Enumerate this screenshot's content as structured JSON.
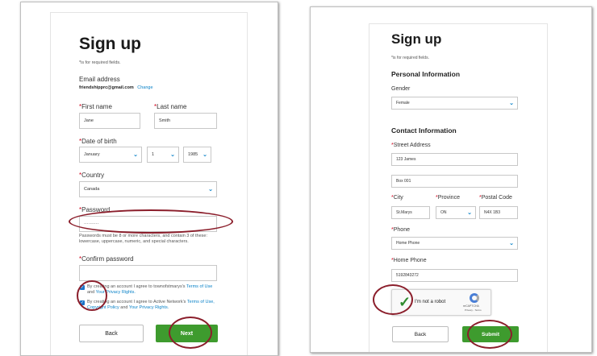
{
  "left": {
    "title": "Sign up",
    "required_note": "*is for required fields.",
    "email_label": "Email address",
    "email_value": "friendshipprc@gmail.com",
    "email_change": "Change",
    "first_name_label": "First name",
    "first_name_value": "Jane",
    "last_name_label": "Last name",
    "last_name_value": "Smith",
    "dob_label": "Date of birth",
    "dob_month": "January",
    "dob_day": "1",
    "dob_year": "1985",
    "country_label": "Country",
    "country_value": "Canada",
    "password_label": "Password",
    "password_value": "··········",
    "password_help": "Passwords must be 8 or more characters, and contain 3 of these: lowercase, uppercase, numeric, and special characters.",
    "confirm_label": "Confirm password",
    "consent1_prefix": "By creating an account I agree to townofstmarys's",
    "consent1_terms": "Terms of Use",
    "consent1_and": "and",
    "consent1_privacy": "Your Privacy Rights.",
    "consent2_prefix": "By creating an account I agree to Active Network's",
    "consent2_terms": "Terms of Use, Copyright Policy",
    "consent2_and": "and",
    "consent2_privacy": "Your Privacy Rights.",
    "back_label": "Back",
    "next_label": "Next"
  },
  "right": {
    "title": "Sign up",
    "required_note": "*is for required fields.",
    "personal_heading": "Personal Information",
    "gender_label": "Gender",
    "gender_value": "Female",
    "contact_heading": "Contact Information",
    "street_label": "Street Address",
    "street1_value": "123 James",
    "street2_value": "Box 001",
    "city_label": "City",
    "city_value": "St.Marys",
    "province_label": "Province",
    "province_value": "ON",
    "postal_label": "Postal Code",
    "postal_value": "N4X 1B3",
    "phone_label": "Phone",
    "phone_value": "Home Phone",
    "home_phone_label": "Home Phone",
    "home_phone_value": "5192843272",
    "captcha_label": "I'm not a robot",
    "captcha_brand": "reCAPTCHA",
    "captcha_links": "Privacy - Terms",
    "back_label": "Back",
    "submit_label": "Submit"
  },
  "colors": {
    "accent_green": "#3e9b2e",
    "link_blue": "#0a82c8",
    "required_red": "#d0021b",
    "annotation_maroon": "#8b1e2b"
  }
}
